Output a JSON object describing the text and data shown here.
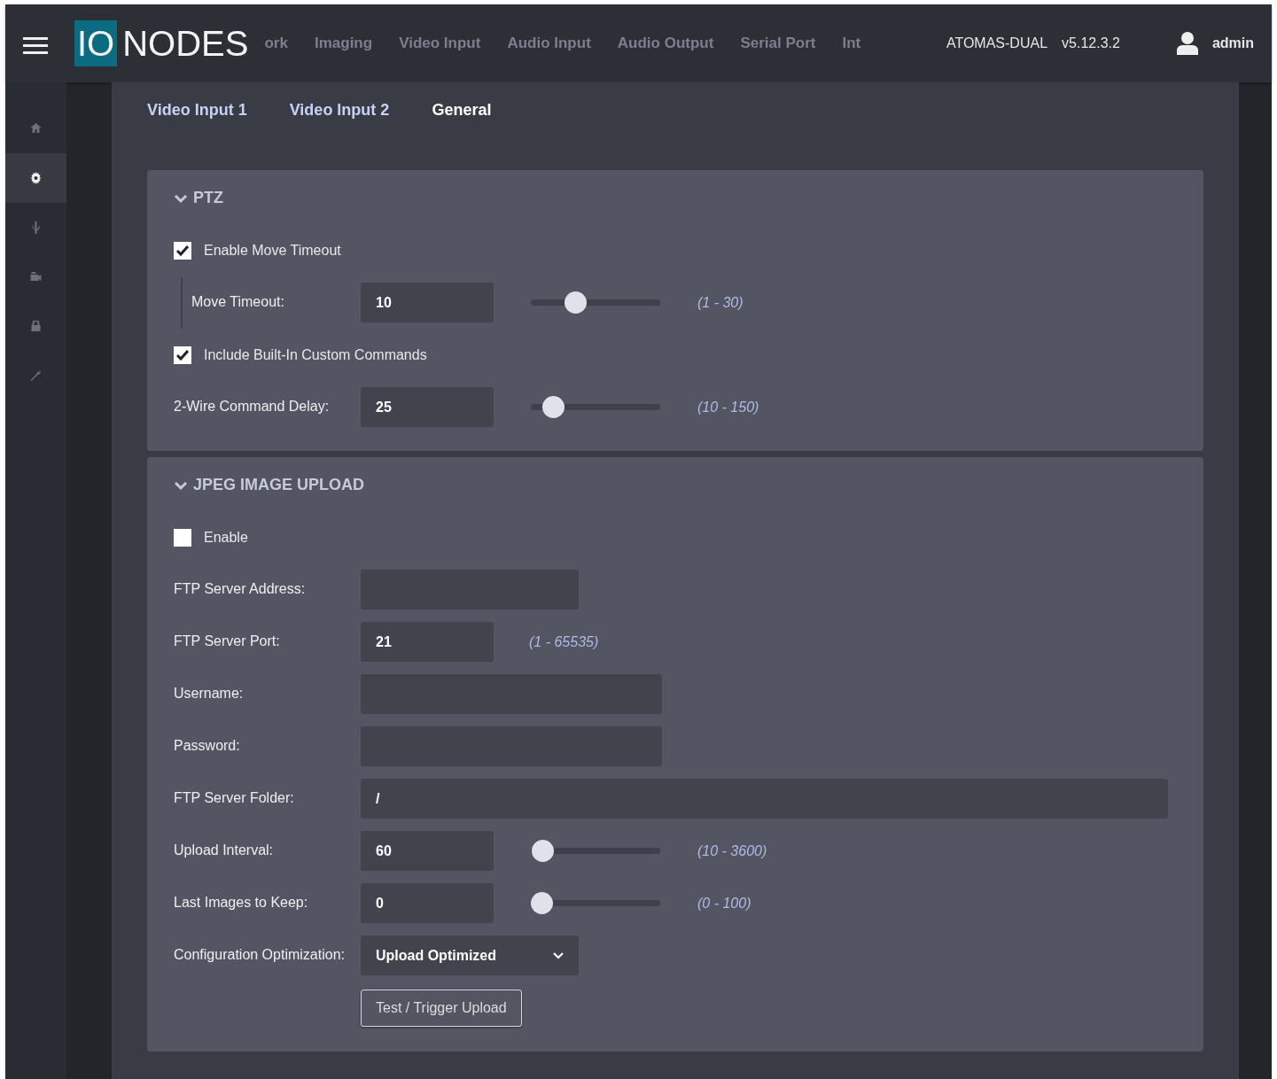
{
  "header": {
    "logo_box": "IO",
    "logo_text": "NODES",
    "nav": [
      {
        "label": "ork"
      },
      {
        "label": "Imaging"
      },
      {
        "label": "Video Input"
      },
      {
        "label": "Audio Input"
      },
      {
        "label": "Audio Output"
      },
      {
        "label": "Serial Port"
      },
      {
        "label": "Int"
      }
    ],
    "device": "ATOMAS-DUAL",
    "version": "v5.12.3.2",
    "user": "admin"
  },
  "sidebar": [
    {
      "kind": "home",
      "selected": false
    },
    {
      "kind": "gear",
      "selected": true
    },
    {
      "kind": "usb",
      "selected": false
    },
    {
      "kind": "camera",
      "selected": false
    },
    {
      "kind": "lock",
      "selected": false
    },
    {
      "kind": "wrench",
      "selected": false
    }
  ],
  "tabs": [
    {
      "label": "Video Input 1",
      "selected": false
    },
    {
      "label": "Video Input 2",
      "selected": false
    },
    {
      "label": "General",
      "selected": true
    }
  ],
  "sections": [
    {
      "title": "PTZ",
      "expanded": true,
      "rows": [
        {
          "kind": "checkbox",
          "label": "Enable Move Timeout",
          "checked": true
        },
        {
          "kind": "slider",
          "label": "Move Timeout:",
          "value": "10",
          "range": "(1 - 30)",
          "level": 0.31,
          "indented": true
        },
        {
          "kind": "checkbox",
          "label": "Include Built-In Custom Commands",
          "checked": true
        },
        {
          "kind": "slider",
          "label": "2-Wire Command Delay:",
          "value": "25",
          "range": "(10 - 150)",
          "level": 0.11,
          "indented": false
        }
      ]
    },
    {
      "title": "JPEG IMAGE UPLOAD",
      "expanded": true,
      "rows": [
        {
          "kind": "checkbox",
          "label": "Enable",
          "checked": false
        },
        {
          "kind": "input",
          "label": "FTP Server Address:"
        },
        {
          "kind": "input",
          "label": "FTP Server Port:",
          "value": "21",
          "range": "(1 - 65535)"
        },
        {
          "kind": "input",
          "label": "Username:"
        },
        {
          "kind": "input",
          "label": "Password:"
        },
        {
          "kind": "input",
          "label": "FTP Server Folder:",
          "value": "/"
        },
        {
          "kind": "slider",
          "label": "Upload Interval:",
          "value": "60",
          "range": "(10 - 3600)",
          "level": 0.01,
          "indented": false
        },
        {
          "kind": "slider",
          "label": "Last Images to Keep:",
          "value": "0",
          "range": "(0 - 100)",
          "level": 0,
          "indented": false
        },
        {
          "kind": "select",
          "label": "Configuration Optimization:",
          "value": "Upload Optimized"
        },
        {
          "kind": "button",
          "label": "Test / Trigger Upload"
        }
      ]
    }
  ]
}
